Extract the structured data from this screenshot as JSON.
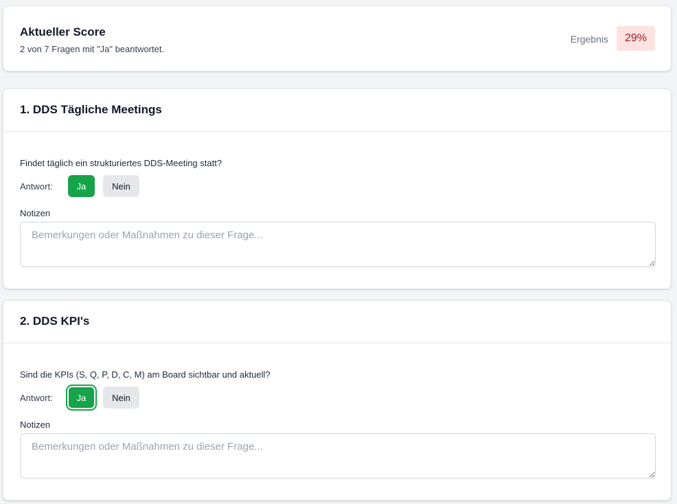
{
  "score": {
    "title": "Aktueller Score",
    "subtitle": "2 von 7 Fragen mit \"Ja\" beantwortet.",
    "result_label": "Ergebnis",
    "result_value": "29%",
    "result_color": "#991b1b",
    "result_bg": "#fee2e2"
  },
  "sections": [
    {
      "title": "1. DDS Tägliche Meetings",
      "question": "Findet täglich ein strukturiertes DDS-Meeting statt?",
      "answer_label": "Antwort:",
      "yes_label": "Ja",
      "no_label": "Nein",
      "selected": "Ja",
      "notes_label": "Notizen",
      "notes_placeholder": "Bemerkungen oder Maßnahmen zu dieser Frage...",
      "notes_value": ""
    },
    {
      "title": "2. DDS KPI's",
      "question": "Sind die KPIs (S, Q, P, D, C, M) am Board sichtbar und aktuell?",
      "answer_label": "Antwort:",
      "yes_label": "Ja",
      "no_label": "Nein",
      "selected": "Ja",
      "notes_label": "Notizen",
      "notes_placeholder": "Bemerkungen oder Maßnahmen zu dieser Frage...",
      "notes_value": ""
    }
  ],
  "colors": {
    "yes_active": "#16a34a",
    "no_inactive": "#e5e7eb"
  }
}
